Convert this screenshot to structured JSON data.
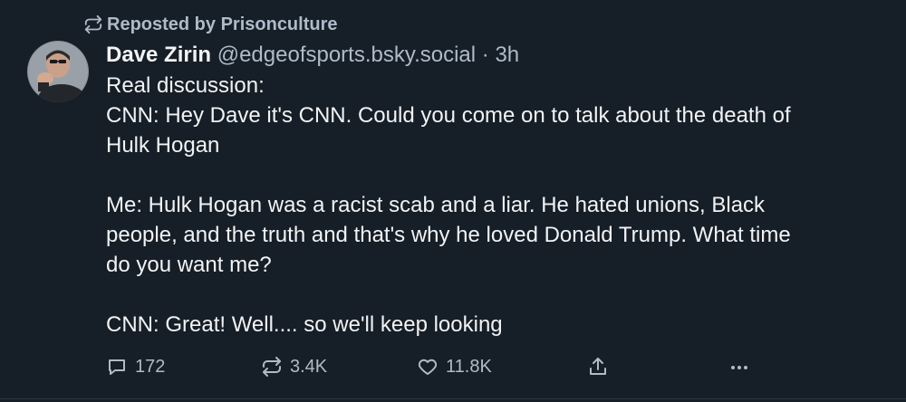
{
  "repost": {
    "label": "Reposted by Prisonculture",
    "icon": "repost-icon"
  },
  "post": {
    "display_name": "Dave Zirin",
    "handle": "@edgeofsports.bsky.social",
    "separator": "·",
    "time": "3h",
    "text": "Real discussion:\nCNN: Hey Dave it's CNN. Could you come on to talk about the death of\nHulk Hogan\n\nMe: Hulk Hogan was a racist scab and a liar. He hated unions, Black\npeople, and the truth and that's why he loved Donald Trump. What time\ndo you want me?\n\nCNN: Great! Well.... so we'll keep looking"
  },
  "actions": {
    "reply_count": "172",
    "repost_count": "3.4K",
    "like_count": "11.8K",
    "share_icon": "share-icon",
    "more_icon": "more-icon"
  },
  "colors": {
    "background": "#161e27",
    "text": "#f1f3f5",
    "muted": "#aebbc9"
  }
}
